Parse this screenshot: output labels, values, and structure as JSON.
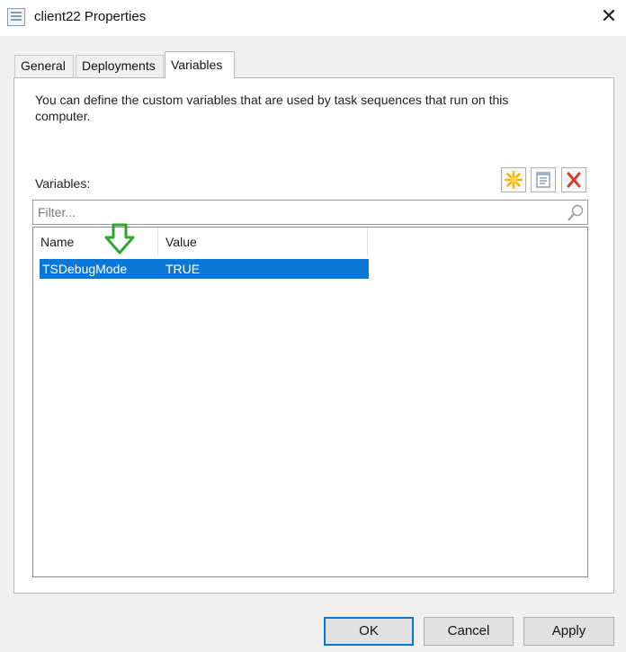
{
  "window": {
    "title": "client22 Properties",
    "close_glyph": "✕",
    "icon": "properties-page-icon"
  },
  "tabs": [
    {
      "label": "General",
      "active": false
    },
    {
      "label": "Deployments",
      "active": false
    },
    {
      "label": "Variables",
      "active": true
    }
  ],
  "variables_tab": {
    "description": "You can define the custom variables that are used by task sequences that run on this computer.",
    "variables_label": "Variables:",
    "toolbar": {
      "new_icon": "new-star-icon",
      "properties_icon": "properties-icon",
      "delete_icon": "delete-x-icon"
    },
    "filter": {
      "placeholder": "Filter...",
      "value": "",
      "icon": "search-icon"
    },
    "columns": [
      "Name",
      "Value"
    ],
    "rows": [
      {
        "name": "TSDebugMode",
        "value": "TRUE",
        "selected": true
      }
    ],
    "annotation_icon": "green-down-arrow-icon"
  },
  "buttons": {
    "ok": "OK",
    "cancel": "Cancel",
    "apply": "Apply"
  },
  "colors": {
    "selection": "#0b78d7",
    "arrow": "#2ea52e",
    "delete": "#d63a2a",
    "new_star": "#f4b400",
    "default_button_border": "#0078d7"
  }
}
